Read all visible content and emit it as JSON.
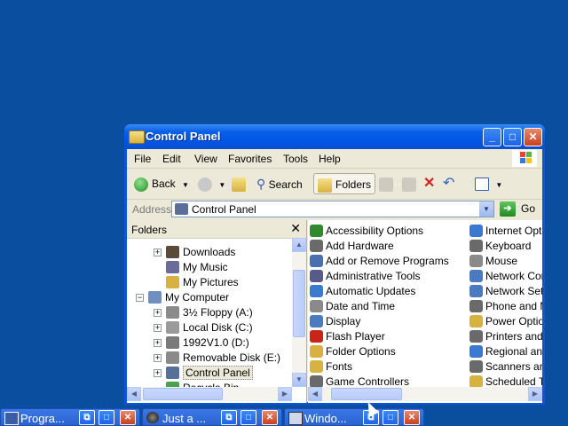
{
  "window": {
    "title": "Control Panel",
    "menu": [
      "File",
      "Edit",
      "View",
      "Favorites",
      "Tools",
      "Help"
    ],
    "toolbar": {
      "back": "Back",
      "search": "Search",
      "folders": "Folders"
    },
    "address": {
      "label": "Address",
      "value": "Control Panel",
      "go": "Go"
    },
    "folders_pane": {
      "title": "Folders",
      "tree": [
        {
          "label": "Downloads",
          "expander": "+",
          "icon": "downloads-icon",
          "color": "#5b4a3a"
        },
        {
          "label": "My Music",
          "expander": "",
          "icon": "my-music-icon",
          "color": "#6b6b9a"
        },
        {
          "label": "My Pictures",
          "expander": "",
          "icon": "my-pictures-icon",
          "color": "#d8b240"
        },
        {
          "label": "My Computer",
          "expander": "−",
          "icon": "my-computer-icon",
          "color": "#6f8fc0"
        },
        {
          "label": "3½ Floppy (A:)",
          "expander": "+",
          "icon": "floppy-icon",
          "color": "#8a8a8a"
        },
        {
          "label": "Local Disk (C:)",
          "expander": "+",
          "icon": "disk-icon",
          "color": "#9a9a9a"
        },
        {
          "label": "1992V1.0 (D:)",
          "expander": "+",
          "icon": "cd-drive-icon",
          "color": "#7a7a7a"
        },
        {
          "label": "Removable Disk (E:)",
          "expander": "+",
          "icon": "removable-disk-icon",
          "color": "#8a8a8a"
        },
        {
          "label": "Control Panel",
          "expander": "+",
          "icon": "control-panel-icon",
          "color": "#5a6e9a",
          "selected": true
        },
        {
          "label": "Recycle Bin",
          "expander": "",
          "icon": "recycle-bin-icon",
          "color": "#4aa24a"
        }
      ]
    },
    "content": {
      "column1": [
        {
          "label": "Accessibility Options",
          "icon": "accessibility-icon",
          "color": "#2f8a2f"
        },
        {
          "label": "Add Hardware",
          "icon": "add-hardware-icon",
          "color": "#6a6a6a"
        },
        {
          "label": "Add or Remove Programs",
          "icon": "add-remove-programs-icon",
          "color": "#4a6fb0"
        },
        {
          "label": "Administrative Tools",
          "icon": "admin-tools-icon",
          "color": "#5a5a8a"
        },
        {
          "label": "Automatic Updates",
          "icon": "updates-icon",
          "color": "#3a7ad0"
        },
        {
          "label": "Date and Time",
          "icon": "date-time-icon",
          "color": "#8a8a8a"
        },
        {
          "label": "Display",
          "icon": "display-icon",
          "color": "#4a7ac0"
        },
        {
          "label": "Flash Player",
          "icon": "flash-icon",
          "color": "#c8241c"
        },
        {
          "label": "Folder Options",
          "icon": "folder-options-icon",
          "color": "#d8b240"
        },
        {
          "label": "Fonts",
          "icon": "fonts-icon",
          "color": "#d8b240"
        },
        {
          "label": "Game Controllers",
          "icon": "game-controller-icon",
          "color": "#6a6a6a"
        }
      ],
      "column2": [
        {
          "label": "Internet Optio",
          "icon": "internet-options-icon",
          "color": "#3a7ad0"
        },
        {
          "label": "Keyboard",
          "icon": "keyboard-icon",
          "color": "#6a6a6a"
        },
        {
          "label": "Mouse",
          "icon": "mouse-icon",
          "color": "#8a8a8a"
        },
        {
          "label": "Network Conn",
          "icon": "network-icon",
          "color": "#4a7ac0"
        },
        {
          "label": "Network Setup",
          "icon": "network-setup-icon",
          "color": "#4a7ac0"
        },
        {
          "label": "Phone and Mo",
          "icon": "phone-icon",
          "color": "#6a6a6a"
        },
        {
          "label": "Power Options",
          "icon": "power-icon",
          "color": "#d8b240"
        },
        {
          "label": "Printers and F",
          "icon": "printer-icon",
          "color": "#6a6a6a"
        },
        {
          "label": "Regional and I",
          "icon": "regional-icon",
          "color": "#3a7ad0"
        },
        {
          "label": "Scanners and",
          "icon": "scanner-icon",
          "color": "#6a6a6a"
        },
        {
          "label": "Scheduled Tas",
          "icon": "scheduled-tasks-icon",
          "color": "#d8b240"
        }
      ]
    }
  },
  "taskbar": [
    {
      "label": "Progra...",
      "icon": "program-icon"
    },
    {
      "label": "Just a ...",
      "icon": "media-icon"
    },
    {
      "label": "Windo...",
      "icon": "windows-icon"
    }
  ]
}
